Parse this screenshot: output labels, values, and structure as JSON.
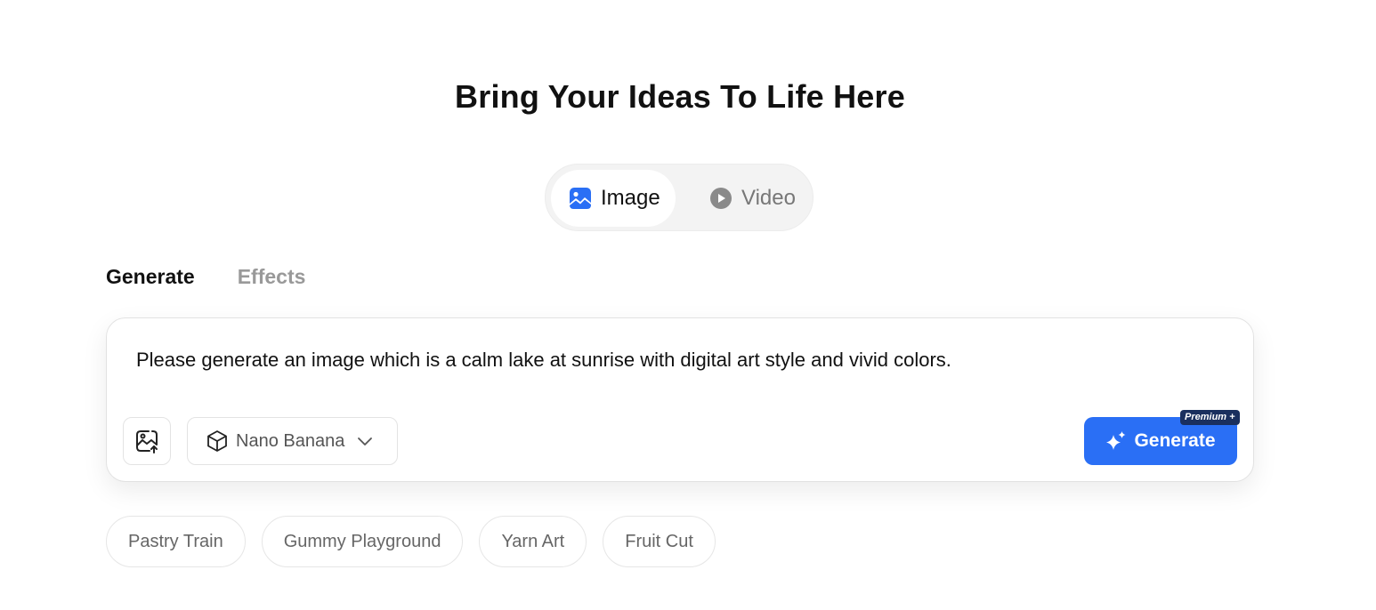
{
  "headline": "Bring Your Ideas To Life Here",
  "mode_switch": {
    "image": {
      "label": "Image",
      "icon": "image-icon",
      "selected": true
    },
    "video": {
      "label": "Video",
      "icon": "play-circle-icon",
      "selected": false
    }
  },
  "tabs": [
    {
      "label": "Generate",
      "active": true
    },
    {
      "label": "Effects",
      "active": false
    }
  ],
  "prompt": {
    "text": "Please generate an image which is a calm lake at sunrise with digital art style and vivid colors."
  },
  "toolbar": {
    "upload_icon": "image-upload-icon",
    "model": {
      "label": "Nano Banana",
      "icon": "cube-icon"
    },
    "generate_label": "Generate",
    "premium_badge": "Premium +"
  },
  "suggestions": [
    "Pastry Train",
    "Gummy Playground",
    "Yarn Art",
    "Fruit Cut"
  ],
  "colors": {
    "accent": "#2a6ff5",
    "badge": "#1a2f5e",
    "muted_text": "#999999"
  }
}
